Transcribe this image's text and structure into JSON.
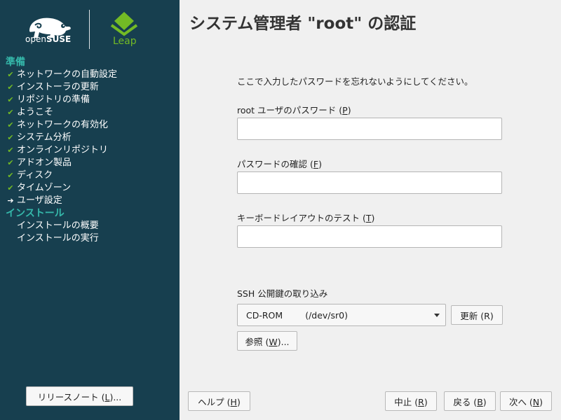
{
  "sidebar": {
    "brand": {
      "opensuse_prefix": "open",
      "opensuse_suffix": "SUSE",
      "leap_label": "Leap"
    },
    "sections": [
      {
        "heading": "準備",
        "items": [
          {
            "label": "ネットワークの自動設定",
            "status": "done"
          },
          {
            "label": "インストーラの更新",
            "status": "done"
          },
          {
            "label": "リポジトリの準備",
            "status": "done"
          },
          {
            "label": "ようこそ",
            "status": "done"
          },
          {
            "label": "ネットワークの有効化",
            "status": "done"
          },
          {
            "label": "システム分析",
            "status": "done"
          },
          {
            "label": "オンラインリポジトリ",
            "status": "done"
          },
          {
            "label": "アドオン製品",
            "status": "done"
          },
          {
            "label": "ディスク",
            "status": "done"
          },
          {
            "label": "タイムゾーン",
            "status": "done"
          },
          {
            "label": "ユーザ設定",
            "status": "current"
          }
        ]
      },
      {
        "heading": "インストール",
        "items": [
          {
            "label": "インストールの概要",
            "status": "pending"
          },
          {
            "label": "インストールの実行",
            "status": "pending"
          }
        ]
      }
    ],
    "release_notes": {
      "text": "リリースノート (",
      "key": "L",
      "suffix": ")..."
    }
  },
  "main": {
    "title": "システム管理者 \"root\" の認証",
    "info": "ここで入力したパスワードを忘れないようにしてください。",
    "password": {
      "label": "root ユーザのパスワード (",
      "key": "P",
      "suffix": ")",
      "value": ""
    },
    "confirm": {
      "label": "パスワードの確認 (",
      "key": "F",
      "suffix": ")",
      "value": ""
    },
    "keyboard_test": {
      "label": "キーボードレイアウトのテスト (",
      "key": "T",
      "suffix": ")",
      "value": ""
    },
    "ssh": {
      "label": "SSH 公開鍵の取り込み",
      "device": "CD-ROM",
      "path": "(/dev/sr0)",
      "refresh": {
        "text": "更新 (R)"
      },
      "browse": {
        "text": "参照 (",
        "key": "W",
        "suffix": ")..."
      }
    }
  },
  "footer": {
    "help": {
      "text": "ヘルプ (",
      "key": "H",
      "suffix": ")"
    },
    "abort": {
      "text": "中止 (",
      "key": "R",
      "suffix": ")"
    },
    "back": {
      "text": "戻る (",
      "key": "B",
      "suffix": ")"
    },
    "next": {
      "text": "次へ (",
      "key": "N",
      "suffix": ")"
    }
  },
  "colors": {
    "sidebar_bg": "#173f4f",
    "heading_teal": "#35b9ab",
    "check_green": "#73ba25",
    "content_bg": "#f0f0f0"
  }
}
